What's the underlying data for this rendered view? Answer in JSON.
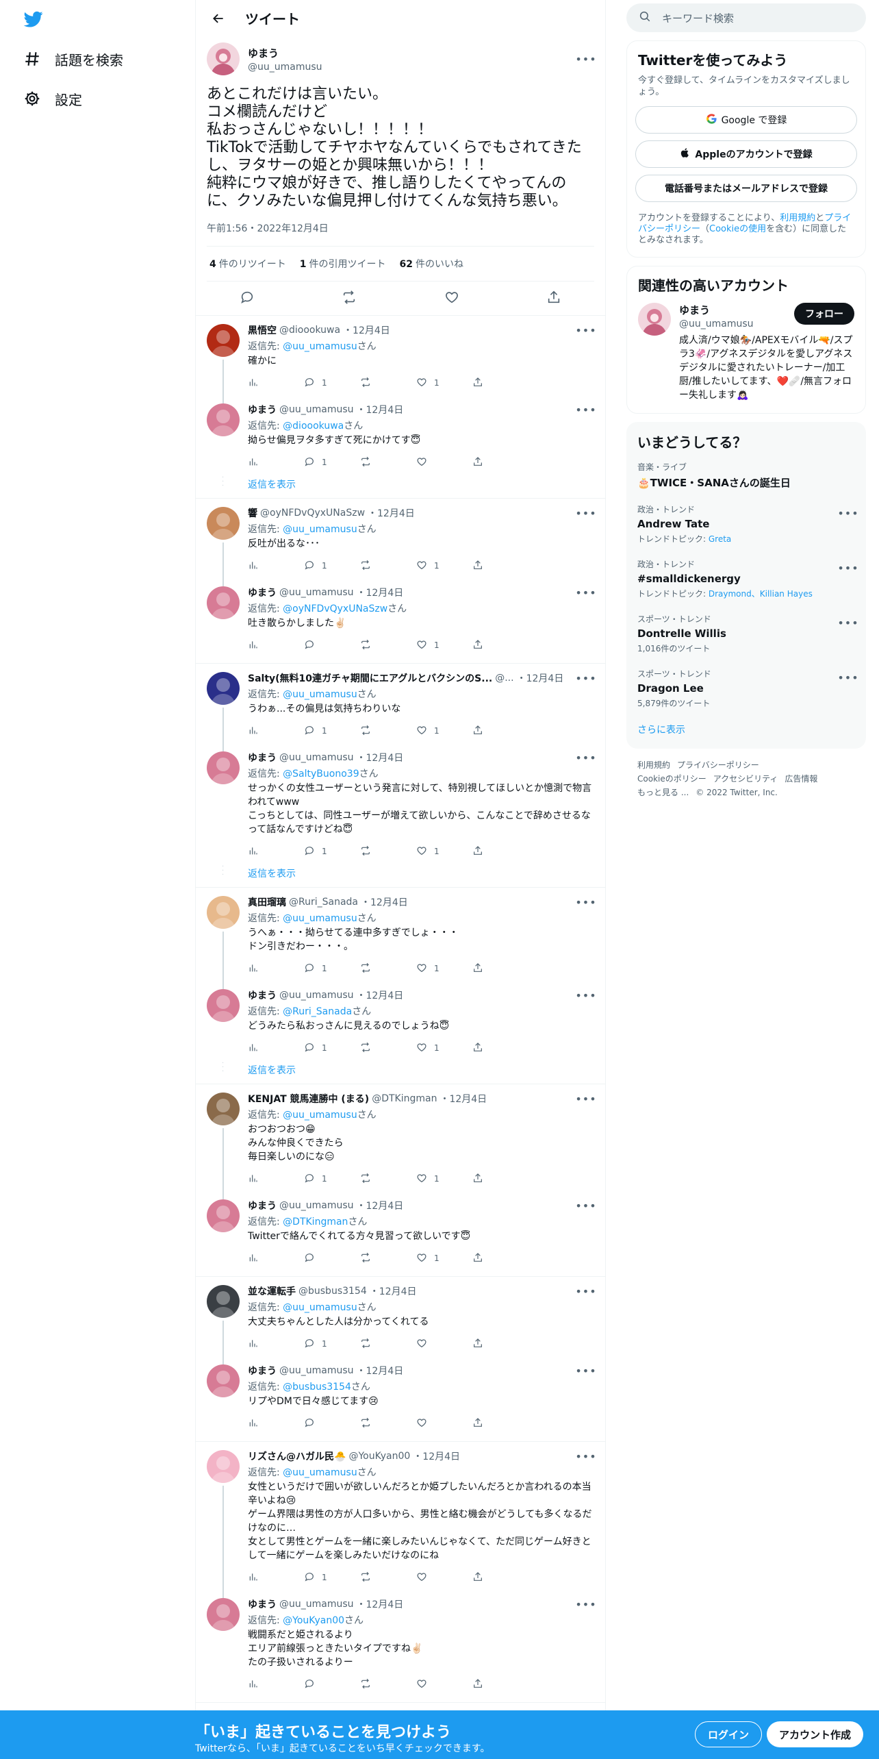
{
  "nav": {
    "explore_label": "話題を検索",
    "settings_label": "設定"
  },
  "header": {
    "title": "ツイート"
  },
  "main_tweet": {
    "display_name": "ゆまう",
    "handle": "@uu_umamusu",
    "text": "あとこれだけは言いたい。\nコメ欄読んだけど\n私おっさんじゃないし！！！！！\nTikTokで活動してチヤホヤなんていくらでもされてきたし、ヲタサーの姫とか興味無いから！！！\n純粋にウマ娘が好きで、推し語りしたくてやってんのに、クソみたいな偏見押し付けてくんな気持ち悪い。",
    "timestamp": "午前1:56・2022年12月4日",
    "retweets_count": "4",
    "retweets_label": "件のリツイート",
    "quotes_count": "1",
    "quotes_label": "件の引用ツイート",
    "likes_count": "62",
    "likes_label": "件のいいね"
  },
  "reply_prefix": "返信先: ",
  "reply_suffix": "さん",
  "show_replies_label": "返信を表示",
  "threads": [
    {
      "replies": [
        {
          "name": "黒悟空",
          "handle": "@dioookuwa",
          "date": "・12月4日",
          "to": "@uu_umamusu",
          "text": "確かに",
          "reply_count": "1",
          "rt_count": "",
          "like_count": "1",
          "avatar_color": "#b22a14",
          "line": true
        },
        {
          "name": "ゆまう",
          "handle": "@uu_umamusu",
          "date": "・12月4日",
          "to": "@dioookuwa",
          "text": "拗らせ偏見ヲタ多すぎて死にかけてす😇",
          "reply_count": "1",
          "rt_count": "",
          "like_count": "",
          "avatar_color": "#d77b95",
          "line": false
        }
      ],
      "show_more": true
    },
    {
      "replies": [
        {
          "name": "響",
          "handle": "@oyNFDvQyxUNaSzw",
          "date": "・12月4日",
          "to": "@uu_umamusu",
          "text": "反吐が出るな･･･",
          "reply_count": "1",
          "rt_count": "",
          "like_count": "1",
          "avatar_color": "#c9895a",
          "line": true
        },
        {
          "name": "ゆまう",
          "handle": "@uu_umamusu",
          "date": "・12月4日",
          "to": "@oyNFDvQyxUNaSzw",
          "text": "吐き散らかしました✌🏻",
          "reply_count": "",
          "rt_count": "",
          "like_count": "1",
          "avatar_color": "#d77b95",
          "line": false
        }
      ],
      "show_more": false
    },
    {
      "replies": [
        {
          "name": "Salty(無料10連ガチャ期間にエアグルとバクシンのS...",
          "handle": "@...",
          "date": "・12月4日",
          "to": "@uu_umamusu",
          "text": "うわぁ...その偏見は気持ちわりいな",
          "reply_count": "1",
          "rt_count": "",
          "like_count": "1",
          "avatar_color": "#2a2f8a",
          "line": true
        },
        {
          "name": "ゆまう",
          "handle": "@uu_umamusu",
          "date": "・12月4日",
          "to": "@SaltyBuono39",
          "text": "せっかくの女性ユーザーという発言に対して、特別視してほしいとか憶測で物言われてwww\nこっちとしては、同性ユーザーが増えて欲しいから、こんなことで辞めさせるなって話なんですけどね😇",
          "reply_count": "1",
          "rt_count": "",
          "like_count": "1",
          "avatar_color": "#d77b95",
          "line": false
        }
      ],
      "show_more": true
    },
    {
      "replies": [
        {
          "name": "真田瑠璃",
          "handle": "@Ruri_Sanada",
          "date": "・12月4日",
          "to": "@uu_umamusu",
          "text": "うへぁ・・・拗らせてる連中多すぎでしょ・・・\nドン引きだわー・・・。",
          "reply_count": "1",
          "rt_count": "",
          "like_count": "1",
          "avatar_color": "#e7b98c",
          "line": true
        },
        {
          "name": "ゆまう",
          "handle": "@uu_umamusu",
          "date": "・12月4日",
          "to": "@Ruri_Sanada",
          "text": "どうみたら私おっさんに見えるのでしょうね😇",
          "reply_count": "1",
          "rt_count": "",
          "like_count": "1",
          "avatar_color": "#d77b95",
          "line": false
        }
      ],
      "show_more": true
    },
    {
      "replies": [
        {
          "name": "KENJAT 競馬連勝中 (まる)",
          "handle": "@DTKingman",
          "date": "・12月4日",
          "to": "@uu_umamusu",
          "text": "おつおつおつ😁\nみんな仲良くできたら\n毎日楽しいのにな😑",
          "reply_count": "1",
          "rt_count": "",
          "like_count": "1",
          "avatar_color": "#8a6a4a",
          "line": true
        },
        {
          "name": "ゆまう",
          "handle": "@uu_umamusu",
          "date": "・12月4日",
          "to": "@DTKingman",
          "text": "Twitterで絡んでくれてる方々見習って欲しいです😇",
          "reply_count": "",
          "rt_count": "",
          "like_count": "1",
          "avatar_color": "#d77b95",
          "line": false
        }
      ],
      "show_more": false
    },
    {
      "replies": [
        {
          "name": "並な運転手",
          "handle": "@busbus3154",
          "date": "・12月4日",
          "to": "@uu_umamusu",
          "text": "大丈夫ちゃんとした人は分かってくれてる",
          "reply_count": "1",
          "rt_count": "",
          "like_count": "",
          "avatar_color": "#3a3f44",
          "line": true
        },
        {
          "name": "ゆまう",
          "handle": "@uu_umamusu",
          "date": "・12月4日",
          "to": "@busbus3154",
          "text": "リプやDMで日々感じてます😢",
          "reply_count": "",
          "rt_count": "",
          "like_count": "",
          "avatar_color": "#d77b95",
          "line": false
        }
      ],
      "show_more": false
    },
    {
      "replies": [
        {
          "name": "リズさん@ハガル民🐣",
          "handle": "@YouKyan00",
          "date": "・12月4日",
          "to": "@uu_umamusu",
          "text": "女性というだけで囲いが欲しいんだろとか姫プしたいんだろとか言われるの本当辛いよね😢\nゲーム界隈は男性の方が人口多いから、男性と絡む機会がどうしても多くなるだけなのに…\n女として男性とゲームを一緒に楽しみたいんじゃなくて、ただ同じゲーム好きとして一緒にゲームを楽しみたいだけなのにね",
          "reply_count": "1",
          "rt_count": "",
          "like_count": "",
          "avatar_color": "#f3b3c6",
          "line": true
        },
        {
          "name": "ゆまう",
          "handle": "@uu_umamusu",
          "date": "・12月4日",
          "to": "@YouKyan00",
          "text": "戦闘系だと姫されるより\nエリア前線張っときたいタイプですね✌🏻\nたの子扱いされるよりー",
          "reply_count": "",
          "rt_count": "",
          "like_count": "",
          "avatar_color": "#d77b95",
          "line": false
        }
      ],
      "show_more": false
    }
  ],
  "right": {
    "search_placeholder": "キーワード検索",
    "signup": {
      "title": "Twitterを使ってみよう",
      "subtitle": "今すぐ登録して、タイムラインをカスタマイズしましょう。",
      "google_label": "Google で登録",
      "apple_label": "Appleのアカウントで登録",
      "phone_label": "電話番号またはメールアドレスで登録",
      "legal_pre": "アカウントを登録することにより、",
      "legal_terms": "利用規約",
      "legal_and": "と",
      "legal_privacy": "プライバシーポリシー",
      "legal_paren_open": "（",
      "legal_cookie": "Cookieの使用",
      "legal_post": "を含む）に同意したとみなされます。"
    },
    "relevant": {
      "title": "関連性の高いアカウント",
      "name": "ゆまう",
      "handle": "@uu_umamusu",
      "follow_label": "フォロー",
      "bio": "成人済/ウマ娘🏇/APEXモバイル🔫/スプラ3🦑/アグネスデジタルを愛しアグネスデジタルに愛されたいトレーナー/加工厨/推したいしてます、❤️🩹/無言フォロー失礼します🙇🏻‍♀️"
    },
    "trends": {
      "title": "いまどうしてる？",
      "items": [
        {
          "context": "音楽・ライブ",
          "title": "🎂TWICE・SANAさんの誕生日",
          "sub_pre": "",
          "sub_link": "",
          "more": false
        },
        {
          "context": "政治・トレンド",
          "title": "Andrew Tate",
          "sub_pre": "トレンドトピック: ",
          "sub_link": "Greta",
          "more": true
        },
        {
          "context": "政治・トレンド",
          "title": "#smalldickenergy",
          "sub_pre": "トレンドトピック: ",
          "sub_link": "Draymond、Killian Hayes",
          "more": true
        },
        {
          "context": "スポーツ・トレンド",
          "title": "Dontrelle Willis",
          "sub_pre": "1,016件のツイート",
          "sub_link": "",
          "more": true
        },
        {
          "context": "スポーツ・トレンド",
          "title": "Dragon Lee",
          "sub_pre": "5,879件のツイート",
          "sub_link": "",
          "more": true
        }
      ],
      "show_more": "さらに表示"
    },
    "footer": {
      "terms": "利用規約",
      "privacy": "プライバシーポリシー",
      "cookie": "Cookieのポリシー",
      "accessibility": "アクセシビリティ",
      "ads": "広告情報",
      "more": "もっと見る ...",
      "copyright": "© 2022 Twitter, Inc."
    }
  },
  "bottombar": {
    "headline": "「いま」起きていることを見つけよう",
    "sub": "Twitterなら、「いま」起きていることをいち早くチェックできます。",
    "login_label": "ログイン",
    "signup_label": "アカウント作成"
  },
  "colors": {
    "accent": "#1d9bf0",
    "text": "#0f1419",
    "secondary": "#536471",
    "border": "#eff3f4"
  }
}
